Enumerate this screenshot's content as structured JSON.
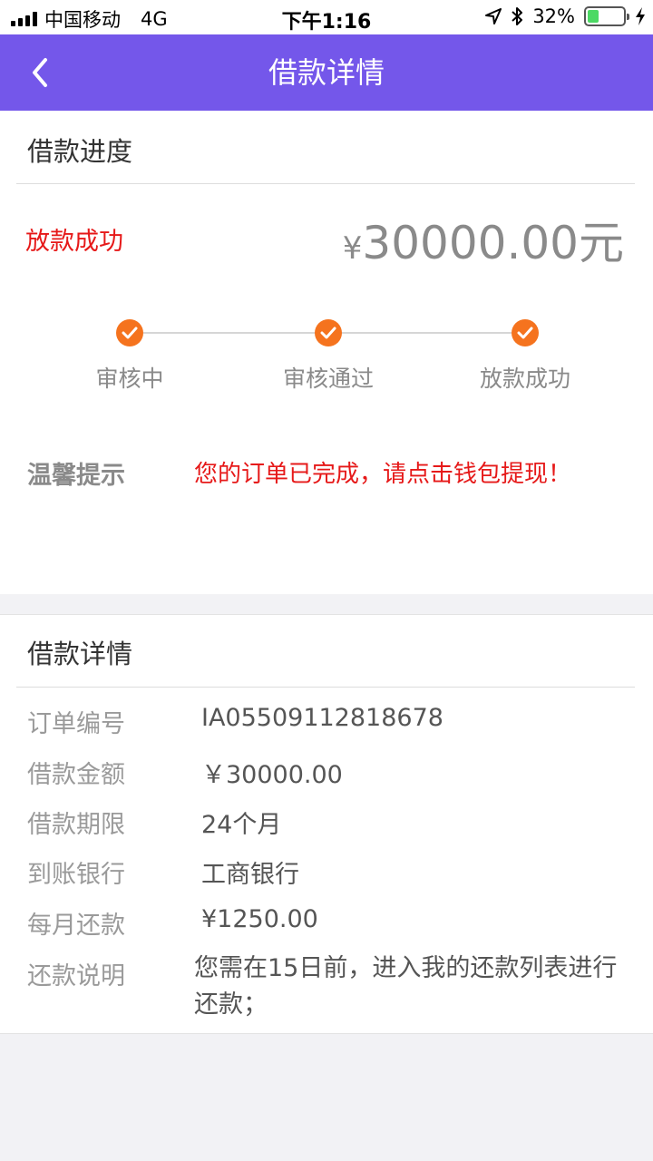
{
  "status_bar": {
    "carrier": "中国移动",
    "network": "4G",
    "time": "下午1:16",
    "battery": "32%",
    "battery_level": 0.32
  },
  "nav": {
    "title": "借款详情"
  },
  "progress": {
    "section_title": "借款进度",
    "status": "放款成功",
    "amount": "30000.00元",
    "currency_symbol": "¥",
    "steps": [
      {
        "label": "审核中"
      },
      {
        "label": "审核通过"
      },
      {
        "label": "放款成功"
      }
    ],
    "tip_label": "温馨提示",
    "tip_text": "您的订单已完成，请点击钱包提现！"
  },
  "details": {
    "section_title": "借款详情",
    "rows": [
      {
        "label": "订单编号",
        "value": "IA05509112818678"
      },
      {
        "label": "借款金额",
        "value": "￥30000.00"
      },
      {
        "label": "借款期限",
        "value": "24个月"
      },
      {
        "label": "到账银行",
        "value": "工商银行"
      },
      {
        "label": "每月还款",
        "value": "¥1250.00"
      }
    ],
    "note_label": "还款说明",
    "note_text": "您需在15日前，进入我的还款列表进行还款；"
  },
  "colors": {
    "nav_bg": "#7457ea",
    "step_active": "#f5731e",
    "alert_red": "#e61919"
  }
}
